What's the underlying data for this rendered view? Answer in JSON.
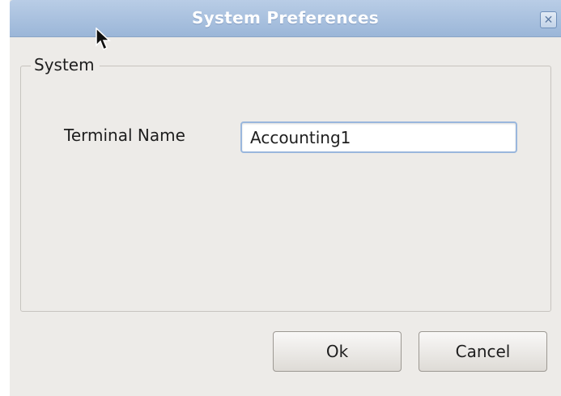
{
  "window": {
    "title": "System Preferences",
    "close_icon": "close-icon"
  },
  "group": {
    "label": "System"
  },
  "terminal": {
    "label": "Terminal Name",
    "value": "Accounting1"
  },
  "buttons": {
    "ok_label": "Ok",
    "cancel_label": "Cancel"
  },
  "colors": {
    "titlebar": "#a9c1df",
    "dialog_bg": "#edebe8",
    "input_focus_border": "#9ab7dd"
  }
}
